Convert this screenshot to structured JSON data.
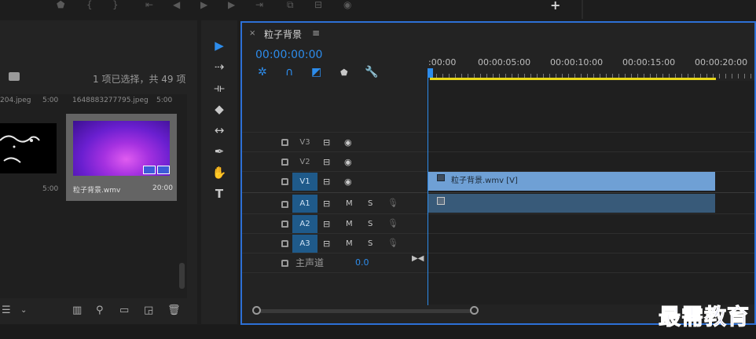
{
  "top_bar": {
    "add_label": "+"
  },
  "project": {
    "selection_status": "1 项已选择，共 49 项",
    "items": [
      {
        "filename": "204.jpeg",
        "duration": "5:00",
        "thumb_duration": "5:00"
      },
      {
        "filename": "1648883277795.jpeg",
        "duration": "5:00"
      },
      {
        "filename": "粒子背景.wmv",
        "duration": "20:00"
      }
    ]
  },
  "timeline": {
    "title": "粒子背景",
    "timecode": "00:00:00:00",
    "ruler_ticks": [
      ":00:00",
      "00:00:05:00",
      "00:00:10:00",
      "00:00:15:00",
      "00:00:20:00"
    ],
    "tracks": [
      {
        "name": "V3",
        "targeted": false
      },
      {
        "name": "V2",
        "targeted": false
      },
      {
        "name": "V1",
        "targeted": true
      },
      {
        "name": "A1",
        "targeted": true,
        "m": "M",
        "s": "S"
      },
      {
        "name": "A2",
        "targeted": true,
        "m": "M",
        "s": "S"
      },
      {
        "name": "A3",
        "targeted": true,
        "m": "M",
        "s": "S"
      }
    ],
    "master": {
      "label": "主声道",
      "value": "0.0"
    },
    "clip_v1_label": "粒子背景.wmv [V]",
    "work_area_color": "#e8d81a",
    "accent_color": "#2d8ceb"
  },
  "watermark": "最需教育"
}
